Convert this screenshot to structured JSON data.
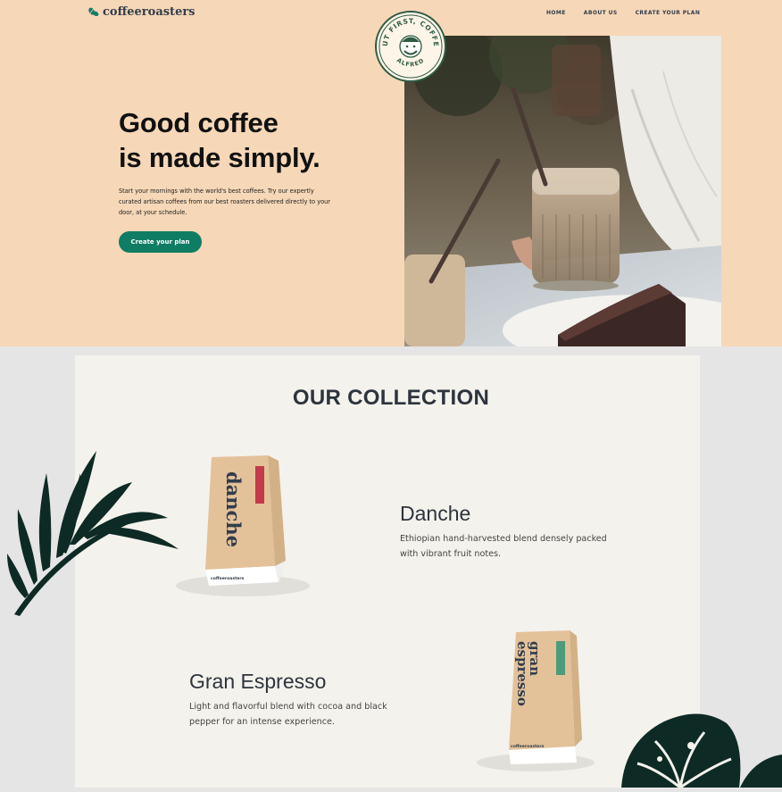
{
  "header": {
    "brand": "coffeeroasters",
    "nav": [
      "HOME",
      "ABOUT US",
      "CREATE YOUR PLAN"
    ]
  },
  "hero": {
    "title_line1": "Good coffee",
    "title_line2": "is made simply.",
    "description": "Start your mornings with the world's best coffees. Try our expertly curated artisan coffees from our best roasters delivered directly to your door, at your schedule.",
    "cta_label": "Create your plan",
    "badge_text_top": "BUT FIRST, COFFEE",
    "badge_text_bottom": "ALFRED"
  },
  "collection": {
    "title": "OUR COLLECTION",
    "products": [
      {
        "name": "Danche",
        "description": "Ethiopian hand-harvested blend densely packed with vibrant fruit notes.",
        "bag_label": "danche",
        "bag_brand": "coffeeroasters",
        "tag_color": "#c23a4b"
      },
      {
        "name": "Gran Espresso",
        "description": "Light and flavorful blend with cocoa and black pepper for an intense experience.",
        "bag_label_line1": "gran",
        "bag_label_line2": "espresso",
        "bag_brand": "coffeeroasters",
        "tag_color": "#4f9a7b"
      }
    ]
  },
  "colors": {
    "hero_bg": "#f6d7b7",
    "accent": "#0f7d64",
    "dark_text": "#2c343e",
    "collection_bg": "#f4f2ec",
    "page_bg": "#e5e5e5"
  }
}
